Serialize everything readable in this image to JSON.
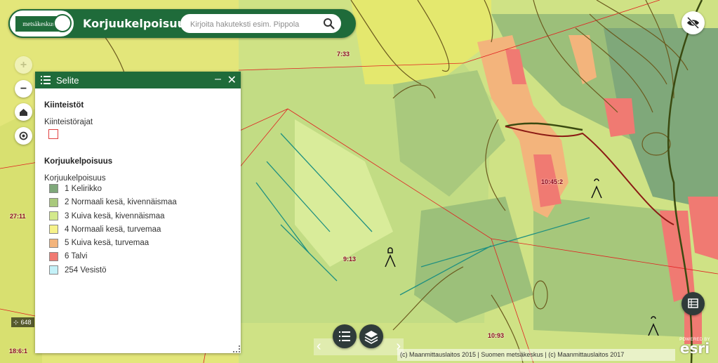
{
  "header": {
    "logo_text": "metsäkeskus",
    "app_title": "Korjuukelpoisuus",
    "search_placeholder": "Kirjoita hakuteksti esim. Pippola",
    "search_value": ""
  },
  "map_controls": {
    "zoom_in": "+",
    "zoom_out": "−",
    "home_icon": "home-icon",
    "locate_icon": "locate-icon",
    "visibility_icon": "eye-off-icon",
    "table_icon": "table-icon"
  },
  "legend": {
    "title": "Selite",
    "minimize": "–",
    "close": "✕",
    "sections": [
      {
        "title": "Kiinteistöt",
        "sublabel": "Kiinteistörajat",
        "swatch_border": "#e04040"
      },
      {
        "title": "Korjuukelpoisuus",
        "sublabel": "Korjuukelpoisuus",
        "classes": [
          {
            "label": "1 Kelirikko",
            "color": "#7fa87a"
          },
          {
            "label": "2 Normaali kesä, kivennäismaa",
            "color": "#a9c97d"
          },
          {
            "label": "3 Kuiva kesä, kivennäismaa",
            "color": "#d3e98c"
          },
          {
            "label": "4 Normaali kesä, turvemaa",
            "color": "#f6f28a"
          },
          {
            "label": "5 Kuiva kesä, turvemaa",
            "color": "#f3b47c"
          },
          {
            "label": "6 Talvi",
            "color": "#f07a72"
          },
          {
            "label": "254 Vesistö",
            "color": "#c4f1f8"
          }
        ]
      }
    ]
  },
  "parcel_labels": [
    "7:33",
    "10:45:2",
    "27:11",
    "9:13",
    "10:93",
    "18:6:1"
  ],
  "scale_text": "648",
  "bottom_toolbar": {
    "list_icon": "list-icon",
    "layers_icon": "layers-icon",
    "prev": "‹",
    "next": "›"
  },
  "attribution": "(c) Maanmittauslaitos 2015 | Suomen metsäkeskus | (c) Maanmittauslaitos 2017",
  "esri": {
    "powered": "POWERED BY",
    "logo": "esri"
  },
  "colors": {
    "brand_green": "#1f6b3a",
    "boundary_red": "#e02020",
    "contour_brown": "#6b5a1e",
    "ditch_teal": "#1f9080"
  }
}
